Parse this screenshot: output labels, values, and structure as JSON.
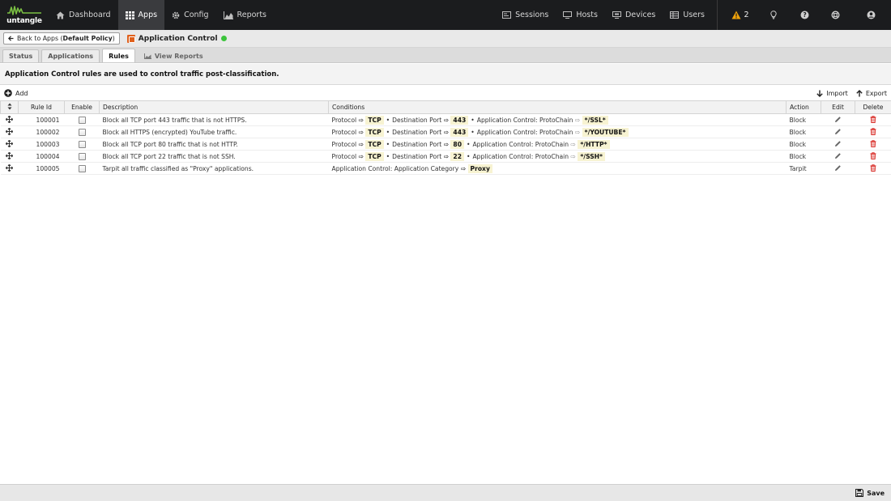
{
  "brand": {
    "logo_text": "untangle"
  },
  "nav": {
    "items": [
      {
        "label": "Dashboard",
        "icon": "home-icon"
      },
      {
        "label": "Apps",
        "icon": "grid-icon",
        "active": true
      },
      {
        "label": "Config",
        "icon": "gear-icon"
      },
      {
        "label": "Reports",
        "icon": "area-chart-icon"
      }
    ],
    "right": [
      {
        "label": "Sessions",
        "icon": "sessions-icon"
      },
      {
        "label": "Hosts",
        "icon": "monitor-icon"
      },
      {
        "label": "Devices",
        "icon": "devices-icon"
      },
      {
        "label": "Users",
        "icon": "users-table-icon"
      }
    ],
    "alert_count": "2"
  },
  "breadcrumb": {
    "back_label": "Back to Apps (",
    "policy": "Default Policy",
    "back_suffix": ")",
    "app_title": "Application Control"
  },
  "tabs": [
    {
      "label": "Status"
    },
    {
      "label": "Applications"
    },
    {
      "label": "Rules",
      "active": true
    },
    {
      "label": "View Reports"
    }
  ],
  "info": "Application Control rules are used to control traffic post-classification.",
  "toolbar": {
    "add": "Add",
    "import": "Import",
    "export": "Export"
  },
  "grid": {
    "headers": {
      "rule_id": "Rule Id",
      "enable": "Enable",
      "description": "Description",
      "conditions": "Conditions",
      "action": "Action",
      "edit": "Edit",
      "delete": "Delete"
    },
    "rows": [
      {
        "id": "100001",
        "description": "Block all TCP port 443 traffic that is not HTTPS.",
        "action": "Block",
        "c1": "Protocol",
        "v1": "TCP",
        "c2": "Destination Port",
        "v2": "443",
        "c3": "Application Control: ProtoChain",
        "v3": "*/SSL*"
      },
      {
        "id": "100002",
        "description": "Block all HTTPS (encrypted) YouTube traffic.",
        "action": "Block",
        "c1": "Protocol",
        "v1": "TCP",
        "c2": "Destination Port",
        "v2": "443",
        "c3": "Application Control: ProtoChain",
        "v3": "*/YOUTUBE*"
      },
      {
        "id": "100003",
        "description": "Block all TCP port 80 traffic that is not HTTP.",
        "action": "Block",
        "c1": "Protocol",
        "v1": "TCP",
        "c2": "Destination Port",
        "v2": "80",
        "c3": "Application Control: ProtoChain",
        "v3": "*/HTTP*"
      },
      {
        "id": "100004",
        "description": "Block all TCP port 22 traffic that is not SSH.",
        "action": "Block",
        "c1": "Protocol",
        "v1": "TCP",
        "c2": "Destination Port",
        "v2": "22",
        "c3": "Application Control: ProtoChain",
        "v3": "*/SSH*"
      },
      {
        "id": "100005",
        "description": "Tarpit all traffic classified as \"Proxy\" applications.",
        "action": "Tarpit",
        "c1": "Application Control: Application Category",
        "v1": "Proxy"
      }
    ]
  },
  "footer": {
    "save": "Save"
  },
  "colors": {
    "topbar": "#1b1c1e",
    "accent_orange": "#e0601c",
    "status_green": "#3cc43c",
    "delete_red": "#d9302b",
    "value_highlight": "#f7f3d2"
  },
  "arrow_glyph": "⇨",
  "bullet_glyph": "•"
}
